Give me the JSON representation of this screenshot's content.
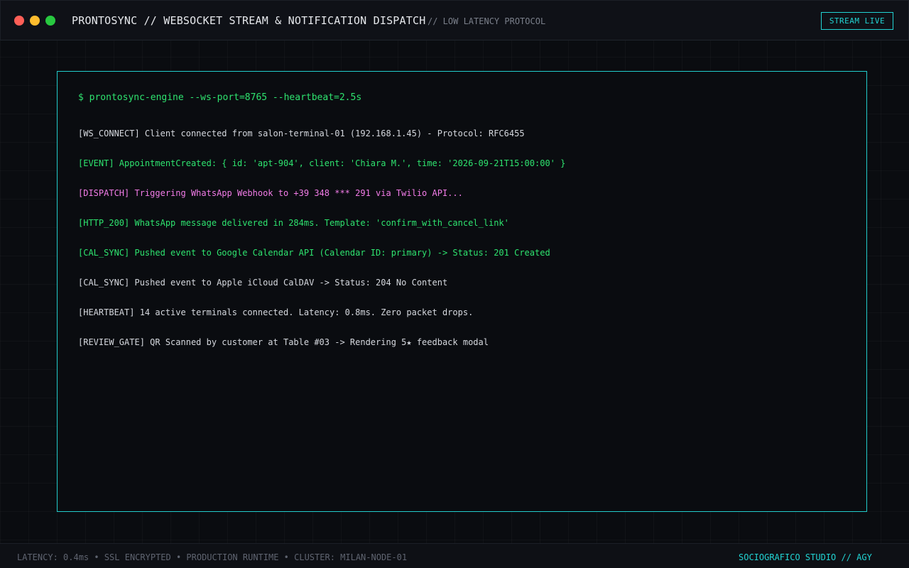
{
  "window": {
    "title": "PRONTOSYNC // WEBSOCKET STREAM & NOTIFICATION DISPATCH",
    "subtitle": "// LOW LATENCY PROTOCOL",
    "badge": "STREAM LIVE"
  },
  "terminal": {
    "prompt": "$ prontosync-engine --ws-port=8765 --heartbeat=2.5s",
    "lines": [
      {
        "text": "[WS_CONNECT] Client connected from salon-terminal-01 (192.168.1.45) - Protocol: RFC6455",
        "color": "white"
      },
      {
        "text": "[EVENT] AppointmentCreated: { id: 'apt-904', client: 'Chiara M.', time: '2026-09-21T15:00:00' }",
        "color": "green"
      },
      {
        "text": "[DISPATCH] Triggering WhatsApp Webhook to +39 348 *** 291 via Twilio API...",
        "color": "pink"
      },
      {
        "text": "[HTTP_200] WhatsApp message delivered in 284ms. Template: 'confirm_with_cancel_link'",
        "color": "green"
      },
      {
        "text": "[CAL_SYNC] Pushed event to Google Calendar API (Calendar ID: primary) -> Status: 201 Created",
        "color": "green"
      },
      {
        "text": "[CAL_SYNC] Pushed event to Apple iCloud CalDAV -> Status: 204 No Content",
        "color": "white"
      },
      {
        "text": "[HEARTBEAT] 14 active terminals connected. Latency: 0.8ms. Zero packet drops.",
        "color": "white"
      },
      {
        "text": "[REVIEW_GATE] QR Scanned by customer at Table #03 -> Rendering 5★ feedback modal",
        "color": "white"
      }
    ]
  },
  "footer": {
    "status": "LATENCY: 0.4ms • SSL ENCRYPTED • PRODUCTION RUNTIME • CLUSTER: MILAN-NODE-01",
    "brand": "SOCIOGRAFICO STUDIO // AGY"
  },
  "colors": {
    "accent": "#22d3d3",
    "log_green": "#2ee36f",
    "log_pink": "#f27ce8",
    "log_white": "#d5d8de"
  }
}
